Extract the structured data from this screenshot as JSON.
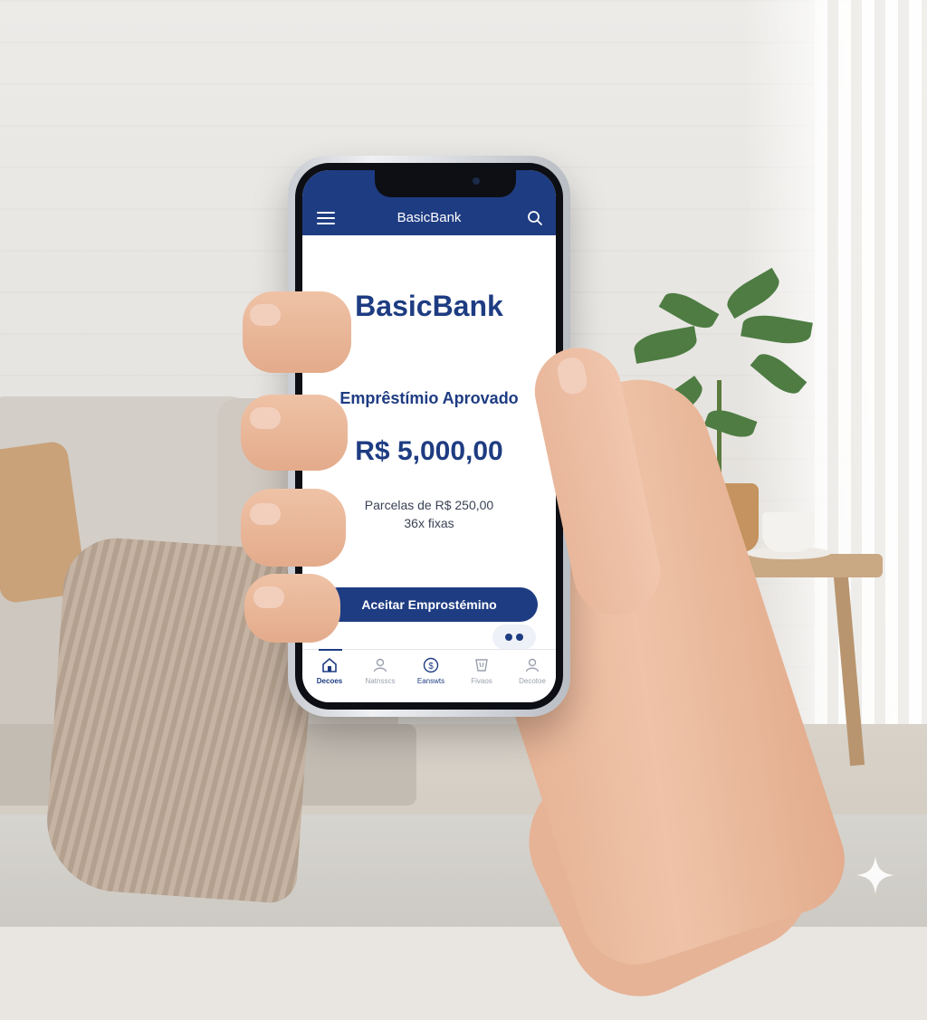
{
  "app": {
    "title": "BasicBank",
    "brand": "BasicBank"
  },
  "loan": {
    "status": "Emprêstímio Aprovado",
    "amount": "R$ 5,000,00",
    "installment_value": "Parcelas de R$ 250,00",
    "installment_terms": "36x fixas",
    "accept_label": "Aceitar Emprostémino"
  },
  "tabs": [
    {
      "label": "Decoes",
      "icon": "home-icon",
      "active": true
    },
    {
      "label": "Natnsscs",
      "icon": "user-icon",
      "active": false
    },
    {
      "label": "Eanswts",
      "icon": "coin-icon",
      "active": false
    },
    {
      "label": "Fivaos",
      "icon": "card-icon",
      "active": false
    },
    {
      "label": "Decotoe",
      "icon": "profile-icon",
      "active": false
    }
  ],
  "icons": {
    "menu": "hamburger-menu-icon",
    "search": "search-icon",
    "chat": "chat-bubble-icon"
  },
  "colors": {
    "brand": "#1e3c82",
    "screen_bg": "#ffffff"
  }
}
